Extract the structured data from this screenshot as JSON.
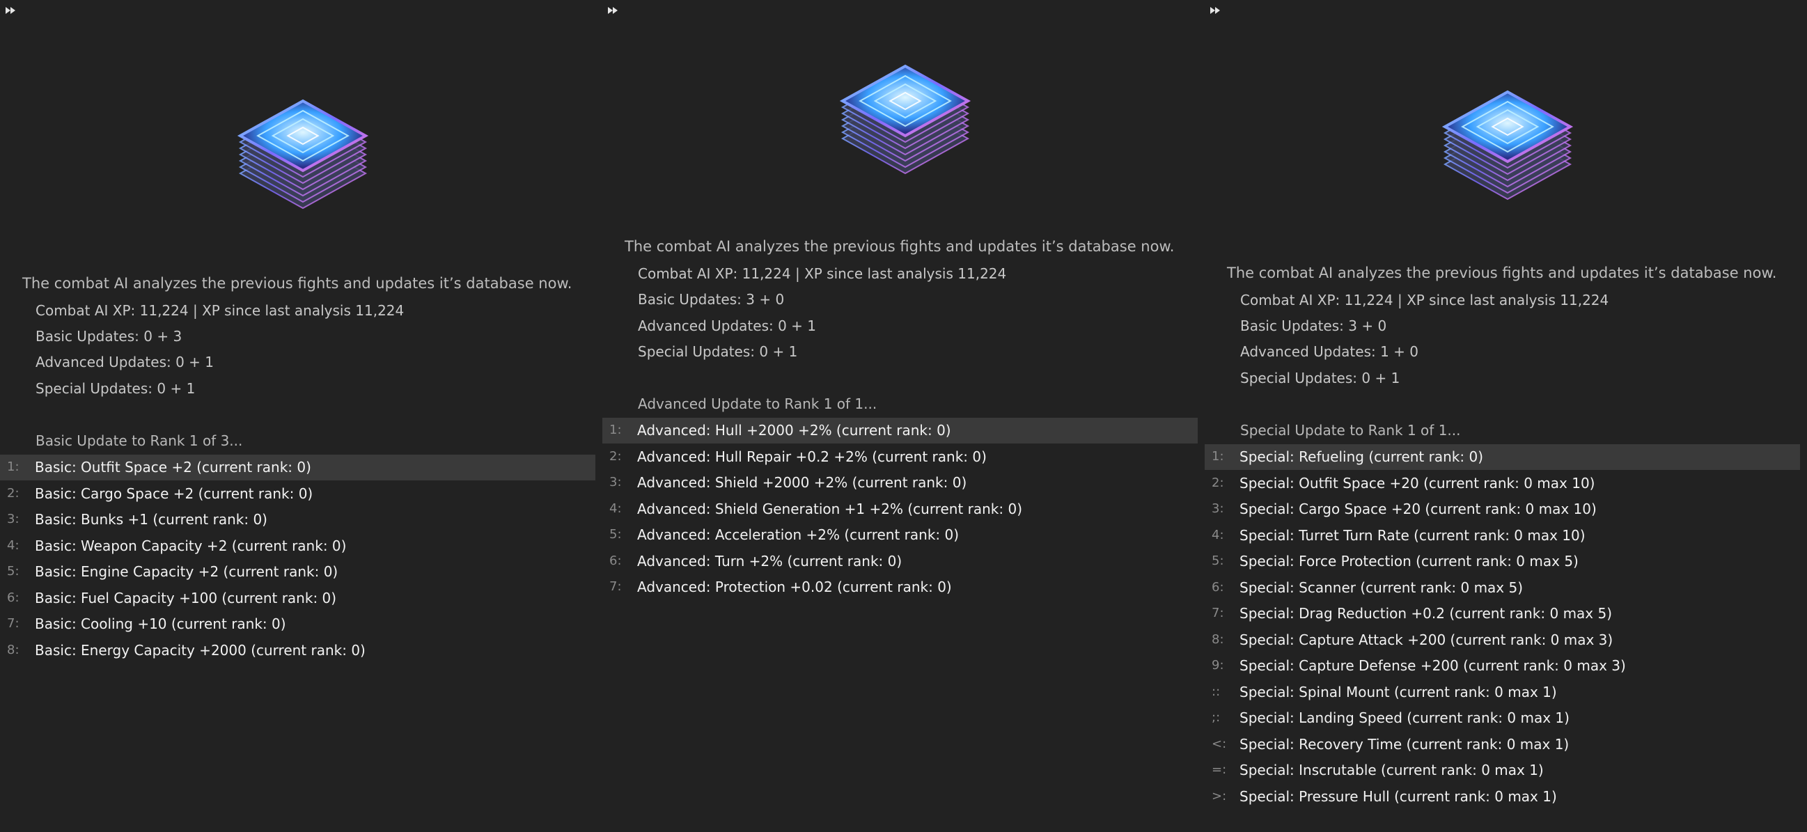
{
  "panels": [
    {
      "title": "The combat AI analyzes the previous fights and updates it’s database now.",
      "stats": [
        "Combat AI XP: 11,224 | XP since last analysis 11,224",
        "Basic Updates: 0 + 3",
        "Advanced Updates: 0 + 1",
        "Special Updates: 0 + 1"
      ],
      "header": "Basic Update to Rank 1 of 3...",
      "selected_index": 0,
      "options": [
        {
          "num": "1:",
          "label": "Basic: Outfit Space +2 (current rank: 0)"
        },
        {
          "num": "2:",
          "label": "Basic: Cargo Space +2 (current rank: 0)"
        },
        {
          "num": "3:",
          "label": "Basic: Bunks +1 (current rank: 0)"
        },
        {
          "num": "4:",
          "label": "Basic: Weapon Capacity +2 (current rank: 0)"
        },
        {
          "num": "5:",
          "label": "Basic: Engine Capacity +2 (current rank: 0)"
        },
        {
          "num": "6:",
          "label": "Basic: Fuel Capacity +100 (current rank: 0)"
        },
        {
          "num": "7:",
          "label": "Basic: Cooling +10 (current rank: 0)"
        },
        {
          "num": "8:",
          "label": "Basic: Energy Capacity +2000 (current rank: 0)"
        }
      ]
    },
    {
      "title": "The combat AI analyzes the previous fights and updates it’s database now.",
      "stats": [
        "Combat AI XP: 11,224 | XP since last analysis 11,224",
        "Basic Updates: 3 + 0",
        "Advanced Updates: 0 + 1",
        "Special Updates: 0 + 1"
      ],
      "header": "Advanced Update to Rank 1 of 1...",
      "selected_index": 0,
      "options": [
        {
          "num": "1:",
          "label": "Advanced: Hull +2000 +2% (current rank: 0)"
        },
        {
          "num": "2:",
          "label": "Advanced: Hull Repair +0.2 +2% (current rank: 0)"
        },
        {
          "num": "3:",
          "label": "Advanced: Shield +2000 +2% (current rank: 0)"
        },
        {
          "num": "4:",
          "label": "Advanced: Shield Generation +1 +2% (current rank: 0)"
        },
        {
          "num": "5:",
          "label": "Advanced: Acceleration +2% (current rank: 0)"
        },
        {
          "num": "6:",
          "label": "Advanced: Turn +2% (current rank: 0)"
        },
        {
          "num": "7:",
          "label": "Advanced: Protection +0.02 (current rank: 0)"
        }
      ]
    },
    {
      "title": "The combat AI analyzes the previous fights and updates it’s database now.",
      "stats": [
        "Combat AI XP: 11,224 | XP since last analysis 11,224",
        "Basic Updates: 3 + 0",
        "Advanced Updates: 1 + 0",
        "Special Updates: 0 + 1"
      ],
      "header": "Special Update to Rank 1 of 1...",
      "selected_index": 0,
      "options": [
        {
          "num": "1:",
          "label": "Special: Refueling (current rank: 0)"
        },
        {
          "num": "2:",
          "label": "Special: Outfit Space +20 (current rank: 0 max 10)"
        },
        {
          "num": "3:",
          "label": "Special: Cargo Space +20 (current rank: 0 max 10)"
        },
        {
          "num": "4:",
          "label": "Special: Turret Turn Rate (current rank: 0 max 10)"
        },
        {
          "num": "5:",
          "label": "Special: Force Protection (current rank: 0 max 5)"
        },
        {
          "num": "6:",
          "label": "Special: Scanner (current rank: 0 max 5)"
        },
        {
          "num": "7:",
          "label": "Special: Drag Reduction +0.2 (current rank: 0 max 5)"
        },
        {
          "num": "8:",
          "label": "Special: Capture Attack +200 (current rank: 0 max 3)"
        },
        {
          "num": "9:",
          "label": "Special: Capture Defense +200 (current rank: 0 max 3)"
        },
        {
          "num": "::",
          "label": "Special: Spinal Mount (current rank: 0 max 1)"
        },
        {
          "num": ";:",
          "label": "Special: Landing Speed (current rank: 0 max 1)"
        },
        {
          "num": "<:",
          "label": "Special: Recovery Time (current rank: 0 max 1)"
        },
        {
          "num": "=:",
          "label": "Special: Inscrutable (current rank: 0 max 1)"
        },
        {
          "num": ">:",
          "label": "Special: Pressure Hull (current rank: 0 max 1)"
        }
      ]
    }
  ],
  "icons": {
    "fast_forward": "fast-forward-icon",
    "chip": "ai-chip-icon"
  },
  "colors": {
    "background": "#222222",
    "selected_row": "#3a3a3a",
    "text": "#f2f2f2",
    "muted": "#8a8a8a"
  }
}
